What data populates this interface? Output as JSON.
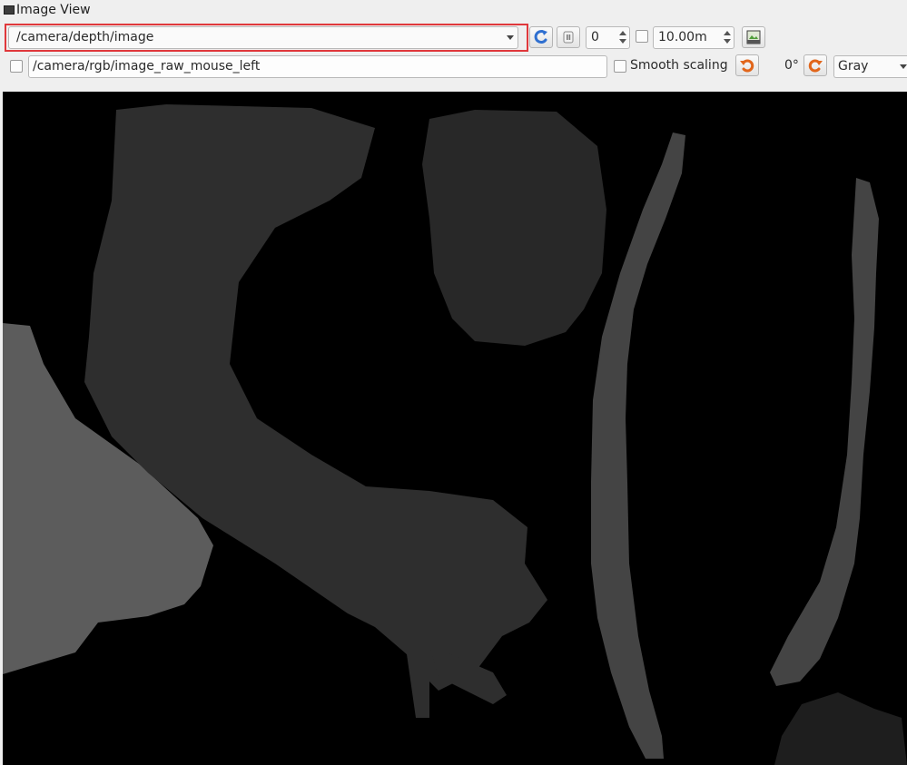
{
  "window": {
    "title": "Image View"
  },
  "toolbar": {
    "topic": {
      "value": "/camera/depth/image",
      "highlighted": true,
      "highlight_color": "#e0383b"
    },
    "frame_spin": {
      "value": "0"
    },
    "max_depth_spin": {
      "value": "10.00m"
    },
    "mouse_topic": {
      "value": "/camera/rgb/image_raw_mouse_left"
    },
    "smooth_scaling": {
      "label": "Smooth scaling",
      "checked": false
    },
    "rotation": {
      "value": "0°"
    },
    "colormap": {
      "value": "Gray"
    }
  },
  "icons": {
    "refresh": "refresh-icon",
    "pause": "pause-icon",
    "save": "save-icon",
    "rotate_left": "rotate-left-icon",
    "rotate_right": "rotate-right-icon"
  },
  "colors": {
    "background": "#efefef",
    "canvas": "#000000",
    "accent_refresh": "#2f6fd0",
    "accent_rotate": "#e1661b"
  }
}
